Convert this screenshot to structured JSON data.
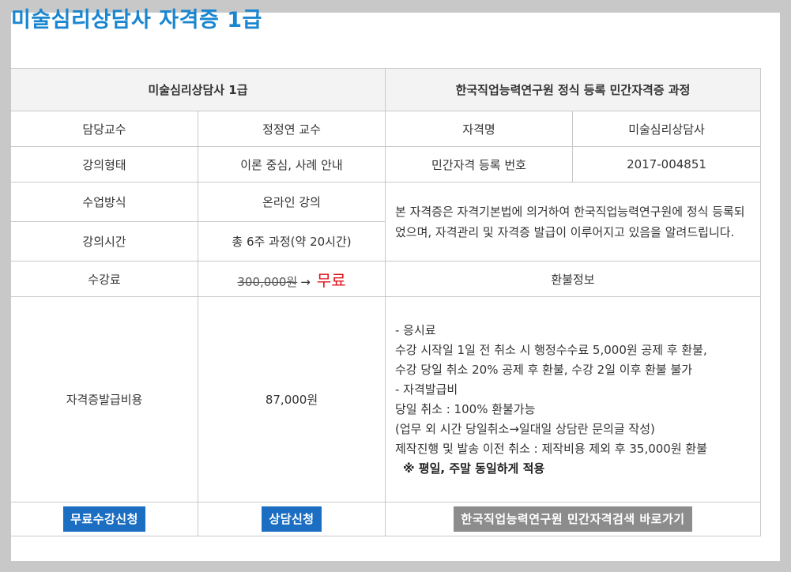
{
  "page": {
    "title": "미술심리상담사 자격증 1급"
  },
  "table": {
    "header_left": "미술심리상담사 1급",
    "header_right": "한국직업능력연구원 정식 등록 민간자격증 과정",
    "instructor_label": "담당교수",
    "instructor_value": "정정연 교수",
    "cert_name_label": "자격명",
    "cert_name_value": "미술심리상담사",
    "lecture_type_label": "강의형태",
    "lecture_type_value": "이론 중심, 사례 안내",
    "reg_number_label": "민간자격 등록 번호",
    "reg_number_value": "2017-004851",
    "class_method_label": "수업방식",
    "class_method_value": "온라인 강의",
    "lecture_time_label": "강의시간",
    "lecture_time_value": "총 6주 과정(약 20시간)",
    "notice_text": "본 자격증은 자격기본법에 의거하여 한국직업능력연구원에 정식 등록되었으며, 자격관리 및 자격증 발급이 이루어지고 있음을 알려드립니다.",
    "tuition_label": "수강료",
    "tuition_original": "300,000원",
    "tuition_arrow": "→",
    "tuition_free": "무료",
    "refund_label": "환불정보",
    "cert_fee_label": "자격증발급비용",
    "cert_fee_value": "87,000원",
    "refund_lines": [
      "- 응시료",
      "  수강 시작일 1일 전 취소 시 행정수수료 5,000원 공제 후 환불,",
      "  수강 당일 취소 20% 공제 후 환불, 수강 2일 이후 환불 불가",
      "- 자격발급비",
      "  당일 취소 : 100% 환불가능",
      "  (업무 외 시간 당일취소→일대일 상담란 문의글 작성)",
      "  제작진행 및 발송 이전 취소 : 제작비용 제외 후 35,000원 환불"
    ],
    "refund_note": "※ 평일, 주말 동일하게 적용"
  },
  "buttons": {
    "free_enroll": "무료수강신청",
    "consult": "상담신청",
    "search_link": "한국직업능력연구원 민간자격검색 바로가기"
  },
  "colors": {
    "title": "#1a86d0",
    "button_blue": "#1b6ec2",
    "button_gray": "#8c8c8c",
    "free_red": "#e0141e"
  }
}
